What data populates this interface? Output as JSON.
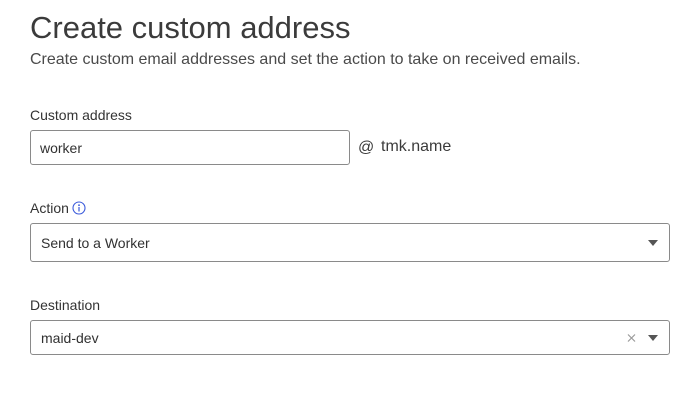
{
  "header": {
    "title": "Create custom address",
    "subtitle": "Create custom email addresses and set the action to take on received emails."
  },
  "custom_address": {
    "label": "Custom address",
    "value": "worker",
    "at_sign": "@",
    "domain": "tmk.name"
  },
  "action": {
    "label": "Action",
    "info_icon": "info-icon",
    "selected": "Send to a Worker",
    "caret_icon": "chevron-down-icon"
  },
  "destination": {
    "label": "Destination",
    "selected": "maid-dev",
    "clear_icon": "close-icon",
    "caret_icon": "chevron-down-icon"
  },
  "colors": {
    "text": "#313131",
    "border": "#8a8a8a",
    "info_accent": "#3b5bdb",
    "background": "#ffffff"
  }
}
